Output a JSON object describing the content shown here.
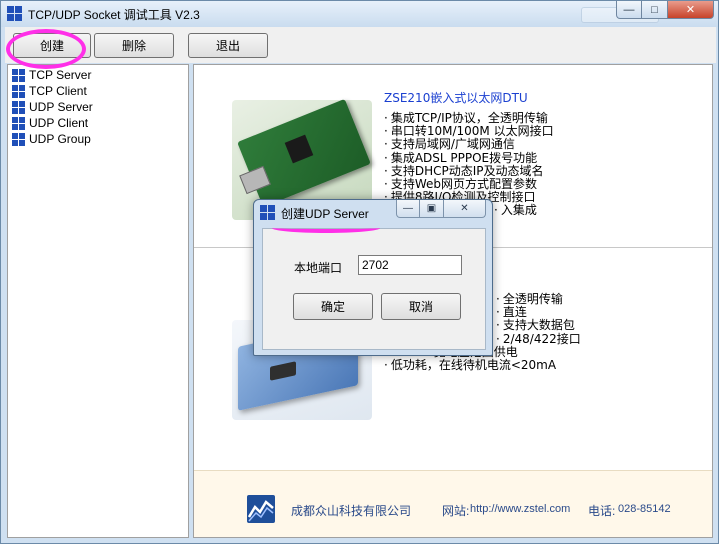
{
  "window": {
    "title": "TCP/UDP Socket 调试工具 V2.3",
    "controls": {
      "minimize": "—",
      "maximize": "□",
      "close": "✕"
    }
  },
  "toolbar": {
    "create_label": "创建",
    "delete_label": "删除",
    "exit_label": "退出"
  },
  "sidebar": {
    "items": [
      {
        "label": "TCP Server"
      },
      {
        "label": "TCP Client"
      },
      {
        "label": "UDP Server"
      },
      {
        "label": "UDP Client"
      },
      {
        "label": "UDP Group"
      }
    ]
  },
  "product1": {
    "title": "ZSE210嵌入式以太网DTU",
    "features": [
      "集成TCP/IP协议，全透明传输",
      "串口转10M/100M 以太网接口",
      "支持局域网/广域网通信",
      "集成ADSL PPPOE拨号功能",
      "支持DHCP动态IP及动态域名",
      "支持Web网页方式配置参数",
      "提供8路I/O检测及控制接口",
      "入集成"
    ]
  },
  "product2": {
    "features": [
      "全透明传输",
      "直连",
      "支持大数据包",
      "2/48/422接口",
      "6V-35V宽电压范围供电",
      "低功耗，在线待机电流<20mA"
    ]
  },
  "footer": {
    "company": "成都众山科技有限公司",
    "website_label": "网站:",
    "website_url": "http://www.zstel.com",
    "phone_label": "电话:",
    "phone_value": "028-85142"
  },
  "dialog": {
    "title": "创建UDP Server",
    "port_label": "本地端口",
    "port_value": "2702",
    "ok_label": "确定",
    "cancel_label": "取消",
    "controls": {
      "minimize": "—",
      "maximize": "▣",
      "close": "✕"
    }
  },
  "colors": {
    "annotation_highlight": "#ff2fe8",
    "product_title": "#1a3fd0",
    "footer_text": "#2a4a8a",
    "logo_blue": "#1f4f9a"
  }
}
